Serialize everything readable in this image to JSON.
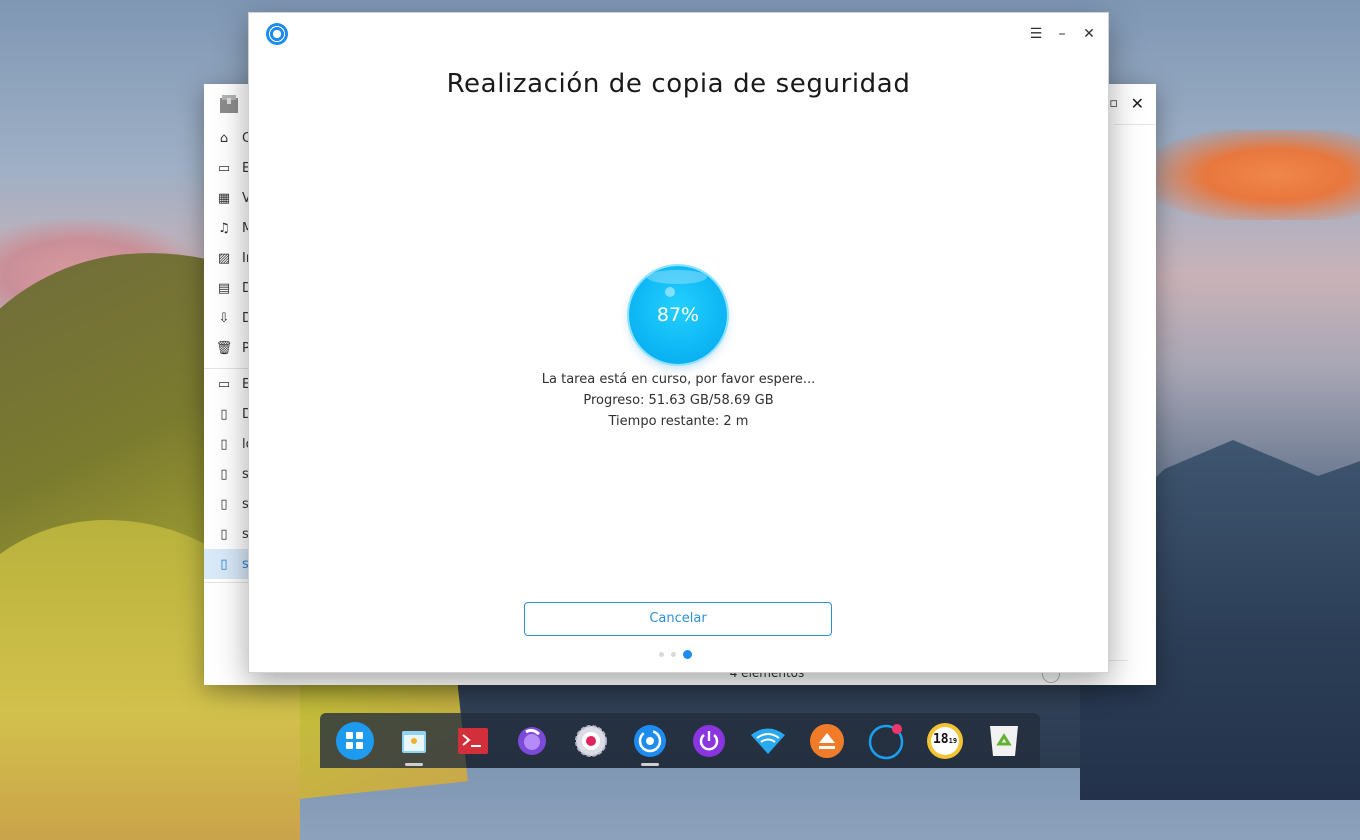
{
  "dialog": {
    "title": "Realización de copia de seguridad",
    "progress_percent": 87,
    "progress_label": "87%",
    "status_text": "La tarea está en curso, por favor espere...",
    "progress_text": "Progreso: 51.63 GB/58.69 GB",
    "time_remaining_text": "Tiempo restante: 2 m",
    "cancel_label": "Cancelar",
    "menu_icon": "hamburger-menu-icon",
    "minimize_icon": "minimize-icon",
    "close_icon": "close-icon",
    "accent_color": "#1d8cf0",
    "page_indicator": {
      "total": 3,
      "current": 3
    }
  },
  "file_manager": {
    "sidebar": [
      {
        "label": "C",
        "icon": "home-icon"
      },
      {
        "label": "E",
        "icon": "desktop-icon"
      },
      {
        "label": "V",
        "icon": "video-icon"
      },
      {
        "label": "M",
        "icon": "music-icon"
      },
      {
        "label": "Ir",
        "icon": "image-icon"
      },
      {
        "label": "D",
        "icon": "document-icon"
      },
      {
        "label": "D",
        "icon": "download-icon"
      },
      {
        "label": "P",
        "icon": "trash-icon"
      },
      {
        "label": "E",
        "icon": "computer-icon"
      },
      {
        "label": "D",
        "icon": "disk-icon"
      },
      {
        "label": "lo",
        "icon": "disk-icon"
      },
      {
        "label": "s",
        "icon": "disk-icon"
      },
      {
        "label": "s",
        "icon": "disk-icon"
      },
      {
        "label": "s",
        "icon": "disk-icon"
      },
      {
        "label": "s",
        "icon": "disk-icon",
        "active": true
      }
    ],
    "status_text": "4 elementos",
    "selected_color": "#2a7bd2"
  },
  "dock": {
    "items": [
      {
        "name": "launcher",
        "icon": "launcher-icon",
        "color": "#1e9bf0"
      },
      {
        "name": "file-manager",
        "icon": "folder-icon",
        "color": "#4db6e8"
      },
      {
        "name": "terminal",
        "icon": "terminal-icon",
        "color": "#d32f3a"
      },
      {
        "name": "browser",
        "icon": "browser-icon",
        "color": "#7b4bd8"
      },
      {
        "name": "settings",
        "icon": "settings-icon",
        "color": "#e9e9ef"
      },
      {
        "name": "backup",
        "icon": "backup-icon",
        "color": "#1d8cf0"
      },
      {
        "name": "shutdown",
        "icon": "power-icon",
        "color": "#8a35e0"
      },
      {
        "name": "network",
        "icon": "wifi-icon",
        "color": "#29a9f0"
      },
      {
        "name": "eject",
        "icon": "eject-icon",
        "color": "#f07c2a"
      },
      {
        "name": "notifications",
        "icon": "notification-icon",
        "color": "#1aa0f0"
      },
      {
        "name": "clock",
        "icon": "clock-icon",
        "color": "#f2c434"
      },
      {
        "name": "trash",
        "icon": "trash-icon",
        "color": "#f2f2f2"
      }
    ],
    "clock_hour": "18",
    "clock_minute": "19"
  }
}
